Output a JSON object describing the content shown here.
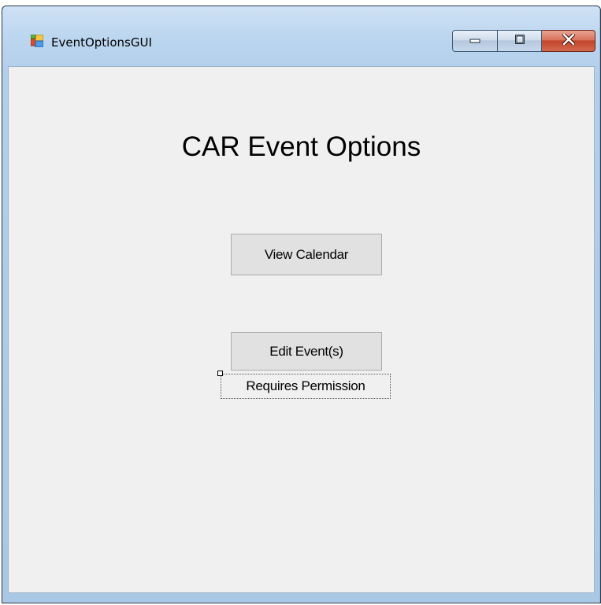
{
  "window": {
    "title": "EventOptionsGUI",
    "icon": "windows-forms-app-icon",
    "caption_buttons": [
      {
        "name": "minimize",
        "icon": "minimize-icon"
      },
      {
        "name": "maximize",
        "icon": "maximize-icon"
      },
      {
        "name": "close",
        "icon": "close-icon"
      }
    ]
  },
  "form": {
    "heading": "CAR Event Options",
    "view_calendar_label": "View Calendar",
    "edit_events_label": "Edit Event(s)",
    "requires_permission_label": "Requires Permission"
  },
  "colors": {
    "client_background": "#f0f0f0",
    "button_background": "#e1e1e1",
    "close_button": "#c2452a"
  }
}
